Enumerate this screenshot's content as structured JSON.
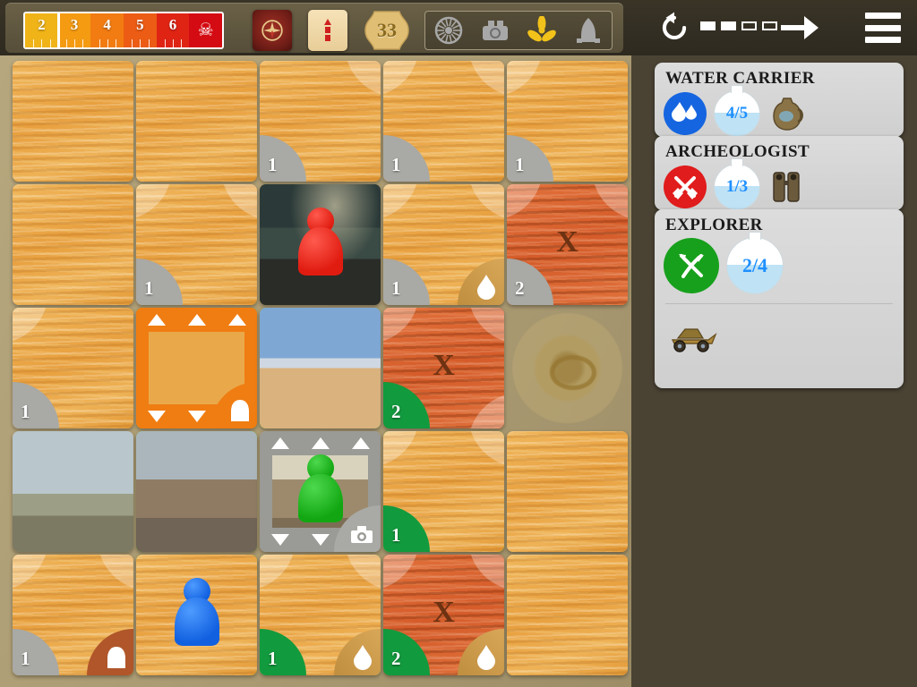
{
  "topbar": {
    "storm_meter": {
      "cells": [
        {
          "label": "2",
          "color": "#f0b418",
          "marker": false
        },
        {
          "label": "3",
          "color": "#f59b12",
          "marker": true
        },
        {
          "label": "4",
          "color": "#f27c12",
          "marker": false
        },
        {
          "label": "5",
          "color": "#ec5c15",
          "marker": false
        },
        {
          "label": "6",
          "color": "#e02414",
          "marker": false
        }
      ],
      "end_icon": "skull-icon",
      "end_glyph": "☠"
    },
    "storm_deck_label": "storm-deck-card",
    "sand_deck_label": "sand-deck-card",
    "sand_supply_count": "33",
    "parts": [
      {
        "name": "turbine",
        "found": false
      },
      {
        "name": "engine",
        "found": false
      },
      {
        "name": "propeller",
        "found": true
      },
      {
        "name": "hull",
        "found": false
      }
    ],
    "part_found_color": "#f2c21a",
    "part_missing_color": "#a8a8a8"
  },
  "controls": {
    "undo_label": "undo-icon",
    "end_turn_label": "end-turn-icon",
    "menu_label": "menu-icon",
    "actions_total": 4,
    "actions_used": 2,
    "pips": [
      "filled",
      "filled",
      "empty",
      "empty"
    ]
  },
  "sidebar": {
    "cards": [
      {
        "role": "WATER CARRIER",
        "role_icon": "water-drops-icon",
        "icon_color": "#1565e0",
        "water": "4/5",
        "item": "water-jug-item"
      },
      {
        "role": "ARCHEOLOGIST",
        "role_icon": "crossed-shovels-icon",
        "icon_color": "#e01c1c",
        "water": "1/3",
        "item": "binoculars-item"
      },
      {
        "role": "EXPLORER",
        "role_icon": "crossed-pick-machete-icon",
        "icon_color": "#17a01c",
        "water": "2/4",
        "item": "dune-buggy-item"
      }
    ]
  },
  "board": {
    "rows": 5,
    "cols": 5,
    "tiles": [
      {
        "id": "r1c1",
        "kind": "sand",
        "sand": null,
        "arcs": [],
        "badge": null,
        "border": null
      },
      {
        "id": "r1c2",
        "kind": "sand",
        "sand": null,
        "arcs": [],
        "badge": null,
        "border": null
      },
      {
        "id": "r1c3",
        "kind": "sand",
        "sand": "1",
        "arcs": [
          "tr"
        ],
        "badge": "gray",
        "border": null
      },
      {
        "id": "r1c4",
        "kind": "sand",
        "sand": "1",
        "arcs": [
          "tl",
          "tr"
        ],
        "badge": "gray",
        "border": null
      },
      {
        "id": "r1c5",
        "kind": "sand",
        "sand": "1",
        "arcs": [
          "tl"
        ],
        "badge": "gray",
        "border": null
      },
      {
        "id": "r2c1",
        "kind": "sand",
        "sand": null,
        "arcs": [],
        "badge": null,
        "border": null
      },
      {
        "id": "r2c2",
        "kind": "sand",
        "sand": "1",
        "arcs": [
          "tl",
          "tr"
        ],
        "badge": "gray",
        "border": null
      },
      {
        "id": "r2c3",
        "kind": "lab",
        "sand": null,
        "arcs": [],
        "badge": null,
        "border": null,
        "pawn": "red"
      },
      {
        "id": "r2c4",
        "kind": "sand",
        "sand": "1",
        "arcs": [
          "tl",
          "tr"
        ],
        "badge": "gray",
        "corner": "water-drop-icon",
        "corner_style": "sandy",
        "border": null
      },
      {
        "id": "r2c5",
        "kind": "sand-dark",
        "sand": "2",
        "arcs": [
          "tl",
          "tr"
        ],
        "badge": "gray",
        "x": true,
        "border": null
      },
      {
        "id": "r3c1",
        "kind": "sand",
        "sand": "1",
        "arcs": [
          "tl"
        ],
        "badge": "gray",
        "border": null
      },
      {
        "id": "r3c2",
        "kind": "bridge",
        "sand": null,
        "arcs": [],
        "badge": null,
        "border": "green",
        "tunnel": "orange",
        "tunnel_icon": "tunnel-icon"
      },
      {
        "id": "r3c3",
        "kind": "domes",
        "sand": null,
        "arcs": [],
        "badge": null,
        "border": "green"
      },
      {
        "id": "r3c4",
        "kind": "sand-dark",
        "sand": "2",
        "arcs": [
          "tl",
          "tr",
          "br"
        ],
        "badge": "green",
        "x": true,
        "border": "red"
      },
      {
        "id": "r3c5",
        "kind": "storm-eye",
        "sand": null,
        "arcs": [],
        "badge": null,
        "border": null
      },
      {
        "id": "r4c1",
        "kind": "windmill",
        "sand": null,
        "arcs": [],
        "badge": null,
        "border": null
      },
      {
        "id": "r4c2",
        "kind": "city",
        "sand": null,
        "arcs": [],
        "badge": null,
        "border": "green"
      },
      {
        "id": "r4c3",
        "kind": "wreck",
        "sand": null,
        "arcs": [],
        "badge": null,
        "border": null,
        "tunnel": "gray",
        "pawn": "green",
        "corner": "gear-part-icon",
        "corner_style": "gray"
      },
      {
        "id": "r4c4",
        "kind": "sand",
        "sand": "1",
        "arcs": [
          "tl",
          "tr"
        ],
        "badge": "green",
        "border": "green"
      },
      {
        "id": "r4c5",
        "kind": "sand",
        "sand": null,
        "arcs": [],
        "badge": null,
        "border": null
      },
      {
        "id": "r5c1",
        "kind": "sand",
        "sand": "1",
        "arcs": [
          "tl",
          "tr"
        ],
        "badge": "gray",
        "corner": "tunnel-icon",
        "corner_style": "brown",
        "border": null
      },
      {
        "id": "r5c2",
        "kind": "sand",
        "sand": null,
        "arcs": [],
        "badge": null,
        "border": "green",
        "pawn": "blue"
      },
      {
        "id": "r5c3",
        "kind": "sand",
        "sand": "1",
        "arcs": [
          "tl",
          "tr"
        ],
        "badge": "green",
        "corner": "water-drop-icon",
        "corner_style": "sandy",
        "border": "green"
      },
      {
        "id": "r5c4",
        "kind": "sand-dark",
        "sand": "2",
        "arcs": [
          "tl",
          "tr"
        ],
        "badge": "green",
        "x": true,
        "corner": "water-drop-icon",
        "corner_style": "sandy",
        "border": "red"
      },
      {
        "id": "r5c5",
        "kind": "sand",
        "sand": null,
        "arcs": [],
        "badge": null,
        "border": null
      }
    ]
  },
  "colors": {
    "board_bg": "#b0a077",
    "panel_bg": "#4a4334",
    "topbar_bg": "#342f24",
    "excavated_badge": "#129a3e",
    "unexcavated_badge": "#a9a9a5"
  }
}
